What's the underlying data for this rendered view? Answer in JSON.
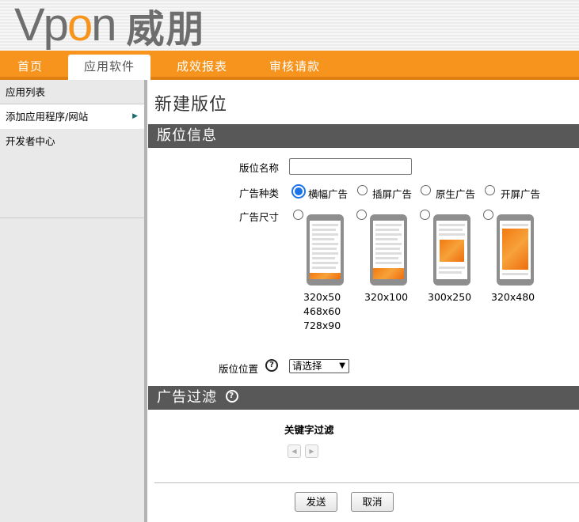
{
  "header": {
    "logo_latin_prefix": "Vp",
    "logo_latin_o": "o",
    "logo_latin_suffix": "n",
    "logo_cjk": "威朋",
    "logo_color": "#6e6e6e",
    "accent_color": "#f7941d"
  },
  "nav": {
    "tabs": [
      {
        "label": "首页",
        "active": false
      },
      {
        "label": "应用软件",
        "active": true
      },
      {
        "label": "成效报表",
        "active": false
      },
      {
        "label": "审核请款",
        "active": false
      }
    ]
  },
  "sidebar": {
    "items": [
      {
        "label": "应用列表",
        "active": false
      },
      {
        "label": "添加应用程序/网站",
        "active": true,
        "icon": "triangle-right-icon"
      },
      {
        "label": "开发者中心",
        "active": false
      }
    ]
  },
  "main": {
    "title": "新建版位",
    "info_section": "版位信息",
    "name_label": "版位名称",
    "name_value": "",
    "type_label": "广告种类",
    "ad_types": [
      {
        "label": "横幅广告",
        "selected": true
      },
      {
        "label": "插屏广告",
        "selected": false
      },
      {
        "label": "原生广告",
        "selected": false
      },
      {
        "label": "开屏广告",
        "selected": false
      }
    ],
    "size_label": "广告尺寸",
    "sizes": [
      {
        "lines": [
          "320x50",
          "468x60",
          "728x90"
        ],
        "selected": false
      },
      {
        "lines": [
          "320x100"
        ],
        "selected": false
      },
      {
        "lines": [
          "300x250"
        ],
        "selected": false
      },
      {
        "lines": [
          "320x480"
        ],
        "selected": false
      }
    ],
    "position_label": "版位位置",
    "position_select": "请选择",
    "filter_section": "广告过滤",
    "keyword_filter_label": "关键字过滤",
    "submit_label": "发送",
    "cancel_label": "取消"
  }
}
